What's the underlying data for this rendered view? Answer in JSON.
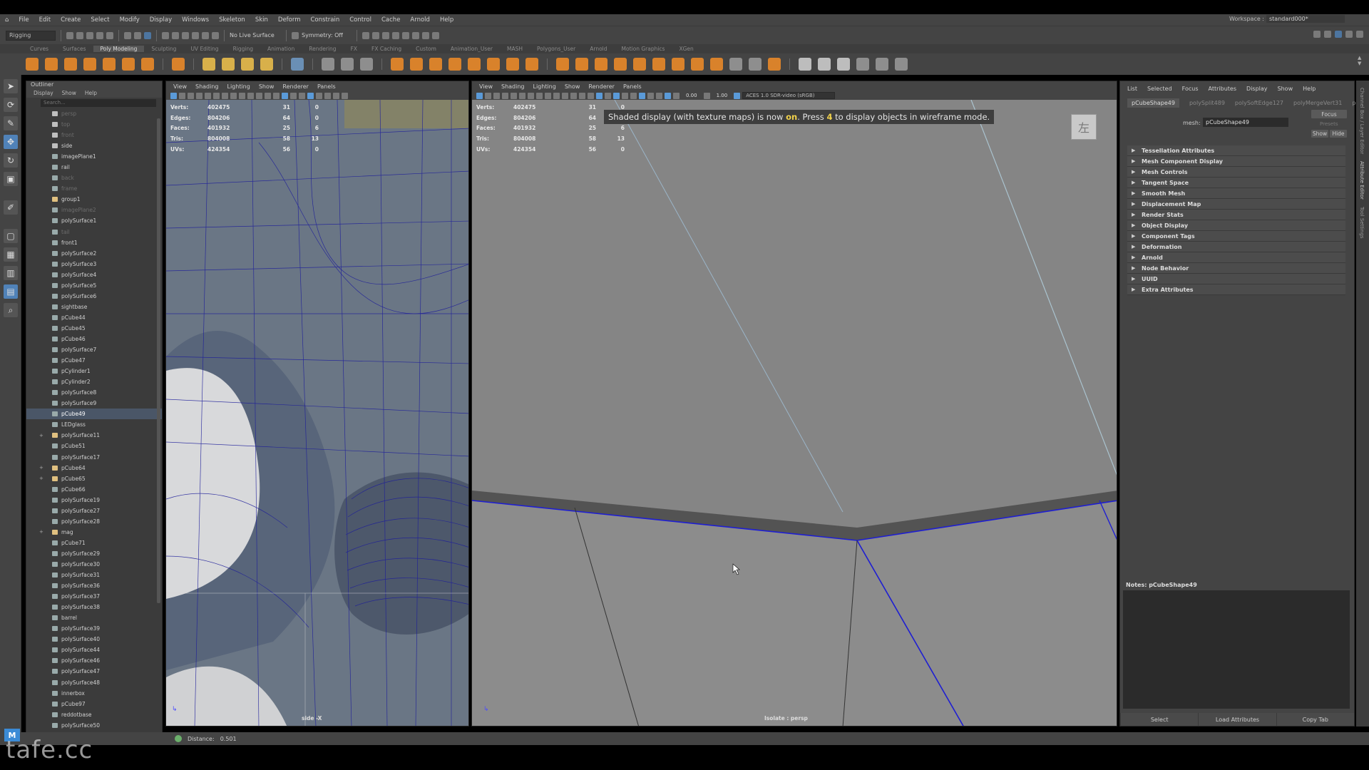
{
  "menubar": {
    "items": [
      "File",
      "Edit",
      "Create",
      "Select",
      "Modify",
      "Display",
      "Windows",
      "Skeleton",
      "Skin",
      "Deform",
      "Constrain",
      "Control",
      "Cache",
      "Arnold",
      "Help"
    ],
    "workspace_label": "Workspace :",
    "workspace_value": "standard000*"
  },
  "statusline": {
    "mode": "Rigging",
    "live_surface": "No Live Surface",
    "symmetry": "Symmetry: Off"
  },
  "shelf": {
    "tabs": [
      "Curves",
      "Surfaces",
      "Poly Modeling",
      "Sculpting",
      "UV Editing",
      "Rigging",
      "Animation",
      "Rendering",
      "FX",
      "FX Caching",
      "Custom",
      "Animation_User",
      "MASH",
      "Polygons_User",
      "Arnold",
      "Motion Graphics",
      "XGen"
    ],
    "active_tab": "Poly Modeling"
  },
  "outliner": {
    "title": "Outliner",
    "menus": [
      "Display",
      "Show",
      "Help"
    ],
    "search_placeholder": "Search...",
    "rows": [
      {
        "label": "persp",
        "dim": true,
        "type": "cam"
      },
      {
        "label": "top",
        "dim": true,
        "type": "cam"
      },
      {
        "label": "front",
        "dim": true,
        "type": "cam"
      },
      {
        "label": "side",
        "dim": false,
        "type": "cam"
      },
      {
        "label": "imagePlane1",
        "dim": false,
        "type": "img"
      },
      {
        "label": "rail",
        "dim": false,
        "type": "mesh"
      },
      {
        "label": "back",
        "dim": true,
        "type": "mesh"
      },
      {
        "label": "frame",
        "dim": true,
        "type": "mesh"
      },
      {
        "label": "group1",
        "dim": false,
        "type": "grp"
      },
      {
        "label": "imagePlane2",
        "dim": true,
        "type": "img"
      },
      {
        "label": "polySurface1",
        "dim": false,
        "type": "mesh"
      },
      {
        "label": "tail",
        "dim": true,
        "type": "mesh"
      },
      {
        "label": "front1",
        "dim": false,
        "type": "mesh"
      },
      {
        "label": "polySurface2",
        "dim": false,
        "type": "mesh"
      },
      {
        "label": "polySurface3",
        "dim": false,
        "type": "mesh"
      },
      {
        "label": "polySurface4",
        "dim": false,
        "type": "mesh"
      },
      {
        "label": "polySurface5",
        "dim": false,
        "type": "mesh"
      },
      {
        "label": "polySurface6",
        "dim": false,
        "type": "mesh"
      },
      {
        "label": "sightbase",
        "dim": false,
        "type": "mesh"
      },
      {
        "label": "pCube44",
        "dim": false,
        "type": "mesh"
      },
      {
        "label": "pCube45",
        "dim": false,
        "type": "mesh"
      },
      {
        "label": "pCube46",
        "dim": false,
        "type": "mesh"
      },
      {
        "label": "polySurface7",
        "dim": false,
        "type": "mesh"
      },
      {
        "label": "pCube47",
        "dim": false,
        "type": "mesh"
      },
      {
        "label": "pCylinder1",
        "dim": false,
        "type": "mesh"
      },
      {
        "label": "pCylinder2",
        "dim": false,
        "type": "mesh"
      },
      {
        "label": "polySurface8",
        "dim": false,
        "type": "mesh"
      },
      {
        "label": "polySurface9",
        "dim": false,
        "type": "mesh"
      },
      {
        "label": "pCube49",
        "dim": false,
        "type": "mesh",
        "selected": true
      },
      {
        "label": "LEDglass",
        "dim": false,
        "type": "mesh"
      },
      {
        "label": "polySurface11",
        "dim": false,
        "type": "grp",
        "expander": "+"
      },
      {
        "label": "pCube51",
        "dim": false,
        "type": "mesh"
      },
      {
        "label": "polySurface17",
        "dim": false,
        "type": "mesh"
      },
      {
        "label": "pCube64",
        "dim": false,
        "type": "grp",
        "expander": "+"
      },
      {
        "label": "pCube65",
        "dim": false,
        "type": "grp",
        "expander": "+"
      },
      {
        "label": "pCube66",
        "dim": false,
        "type": "mesh"
      },
      {
        "label": "polySurface19",
        "dim": false,
        "type": "mesh"
      },
      {
        "label": "polySurface27",
        "dim": false,
        "type": "mesh"
      },
      {
        "label": "polySurface28",
        "dim": false,
        "type": "mesh"
      },
      {
        "label": "mag",
        "dim": false,
        "type": "grp",
        "expander": "+"
      },
      {
        "label": "pCube71",
        "dim": false,
        "type": "mesh"
      },
      {
        "label": "polySurface29",
        "dim": false,
        "type": "mesh"
      },
      {
        "label": "polySurface30",
        "dim": false,
        "type": "mesh"
      },
      {
        "label": "polySurface31",
        "dim": false,
        "type": "mesh"
      },
      {
        "label": "polySurface36",
        "dim": false,
        "type": "mesh"
      },
      {
        "label": "polySurface37",
        "dim": false,
        "type": "mesh"
      },
      {
        "label": "polySurface38",
        "dim": false,
        "type": "mesh"
      },
      {
        "label": "barrel",
        "dim": false,
        "type": "mesh"
      },
      {
        "label": "polySurface39",
        "dim": false,
        "type": "mesh"
      },
      {
        "label": "polySurface40",
        "dim": false,
        "type": "mesh"
      },
      {
        "label": "polySurface44",
        "dim": false,
        "type": "mesh"
      },
      {
        "label": "polySurface46",
        "dim": false,
        "type": "mesh"
      },
      {
        "label": "polySurface47",
        "dim": false,
        "type": "mesh"
      },
      {
        "label": "polySurface48",
        "dim": false,
        "type": "mesh"
      },
      {
        "label": "innerbox",
        "dim": false,
        "type": "mesh"
      },
      {
        "label": "pCube97",
        "dim": false,
        "type": "mesh"
      },
      {
        "label": "reddotbase",
        "dim": false,
        "type": "mesh"
      },
      {
        "label": "polySurface50",
        "dim": false,
        "type": "mesh"
      }
    ]
  },
  "viewport_menus": [
    "View",
    "Shading",
    "Lighting",
    "Show",
    "Renderer",
    "Panels"
  ],
  "hud": {
    "rows": [
      {
        "label": "Verts:",
        "v1": "402475",
        "v2": "31",
        "v3": "0"
      },
      {
        "label": "Edges:",
        "v1": "804206",
        "v2": "64",
        "v3": "0"
      },
      {
        "label": "Faces:",
        "v1": "401932",
        "v2": "25",
        "v3": "6"
      },
      {
        "label": "Tris:",
        "v1": "804008",
        "v2": "58",
        "v3": "13"
      },
      {
        "label": "UVs:",
        "v1": "424354",
        "v2": "56",
        "v3": "0"
      }
    ]
  },
  "viewport_left": {
    "caption": "side -X"
  },
  "viewport_right": {
    "caption": "Isolate : persp",
    "message_pre": "Shaded display (with texture maps) is now ",
    "message_on": "on",
    "message_mid": ". Press ",
    "message_key": "4",
    "message_post": " to display objects in wireframe mode.",
    "exposure": "0.00",
    "gamma": "1.00",
    "colorspace": "ACES 1.0 SDR-video (sRGB)",
    "viewcube_label": "左"
  },
  "attribute_editor": {
    "menus": [
      "List",
      "Selected",
      "Focus",
      "Attributes",
      "Display",
      "Show",
      "Help"
    ],
    "node_tabs": [
      "pCubeShape49",
      "polySplit489",
      "polySoftEdge127",
      "polyMergeVert31",
      "po"
    ],
    "active_tab": "pCubeShape49",
    "mesh_label": "mesh:",
    "mesh_value": "pCubeShape49",
    "focus_label": "Focus",
    "presets_label": "Presets",
    "show_label": "Show",
    "hide_label": "Hide",
    "sections": [
      "Tessellation Attributes",
      "Mesh Component Display",
      "Mesh Controls",
      "Tangent Space",
      "Smooth Mesh",
      "Displacement Map",
      "Render Stats",
      "Object Display",
      "Component Tags",
      "Deformation",
      "Arnold",
      "Node Behavior",
      "UUID",
      "Extra Attributes"
    ],
    "notes_label": "Notes: pCubeShape49",
    "bottom_buttons": [
      "Select",
      "Load Attributes",
      "Copy Tab"
    ]
  },
  "right_strip": {
    "labels": [
      "Channel Box / Layer Editor",
      "Attribute Editor",
      "Tool Settings"
    ]
  },
  "helpline": {
    "label": "Distance:",
    "value": "0.501"
  },
  "watermark": "tafe.cc",
  "colors": {
    "accent": "#5082b8",
    "selected_row": "#4a5667",
    "message_highlight": "#f2d24b",
    "edge_highlight": "#1e1ed2"
  }
}
